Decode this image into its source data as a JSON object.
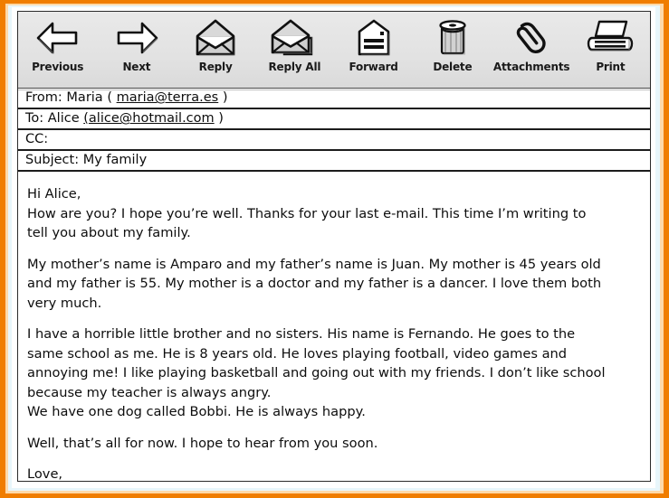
{
  "theme": {
    "frame_color": "#f07d00",
    "toolbar_bg": "#e4e4e4",
    "text_color": "#0d0d0d",
    "border_color": "#1c1c1c"
  },
  "toolbar": {
    "buttons": [
      {
        "id": "previous",
        "label": "Previous",
        "icon": "arrow-left-icon"
      },
      {
        "id": "next",
        "label": "Next",
        "icon": "arrow-right-icon"
      },
      {
        "id": "reply",
        "label": "Reply",
        "icon": "envelope-open-icon"
      },
      {
        "id": "reply-all",
        "label": "Reply All",
        "icon": "envelopes-stacked-icon"
      },
      {
        "id": "forward",
        "label": "Forward",
        "icon": "envelope-forward-icon"
      },
      {
        "id": "delete",
        "label": "Delete",
        "icon": "trash-can-icon"
      },
      {
        "id": "attachments",
        "label": "Attachments",
        "icon": "paperclip-icon"
      },
      {
        "id": "print",
        "label": "Print",
        "icon": "printer-icon"
      }
    ]
  },
  "headers": {
    "from": {
      "label": "From:",
      "name": "Maria",
      "open_paren": "(",
      "email": "maria@terra.es",
      "close_paren": ")"
    },
    "to": {
      "label": "To:",
      "name": "Alice",
      "open_paren": "(",
      "email": "alice@hotmail.com",
      "close_paren": ")"
    },
    "cc": {
      "label": "CC:",
      "value": ""
    },
    "subject": {
      "label": "Subject:",
      "value": "My family"
    }
  },
  "message": {
    "paragraphs": [
      "Hi Alice,\nHow are you? I hope you’re well. Thanks for your last e-mail. This time I’m writing to\ntell you about my family.",
      "My mother’s name is Amparo and my father’s name is Juan. My mother is 45 years old\nand my father is 55. My mother is a doctor and my father is a dancer. I love them both\nvery much.",
      "I have a horrible little brother and no sisters. His name is Fernando. He goes to the\nsame school as me. He is 8 years old. He loves playing football, video games and\nannoying me! I like playing basketball and going out with my friends. I don’t like school\nbecause my teacher is always angry.\nWe have one dog called Bobbi. He is always happy.",
      "Well, that’s all for now. I hope to hear from you soon.",
      "Love,\nMaria xxxxxx"
    ]
  }
}
